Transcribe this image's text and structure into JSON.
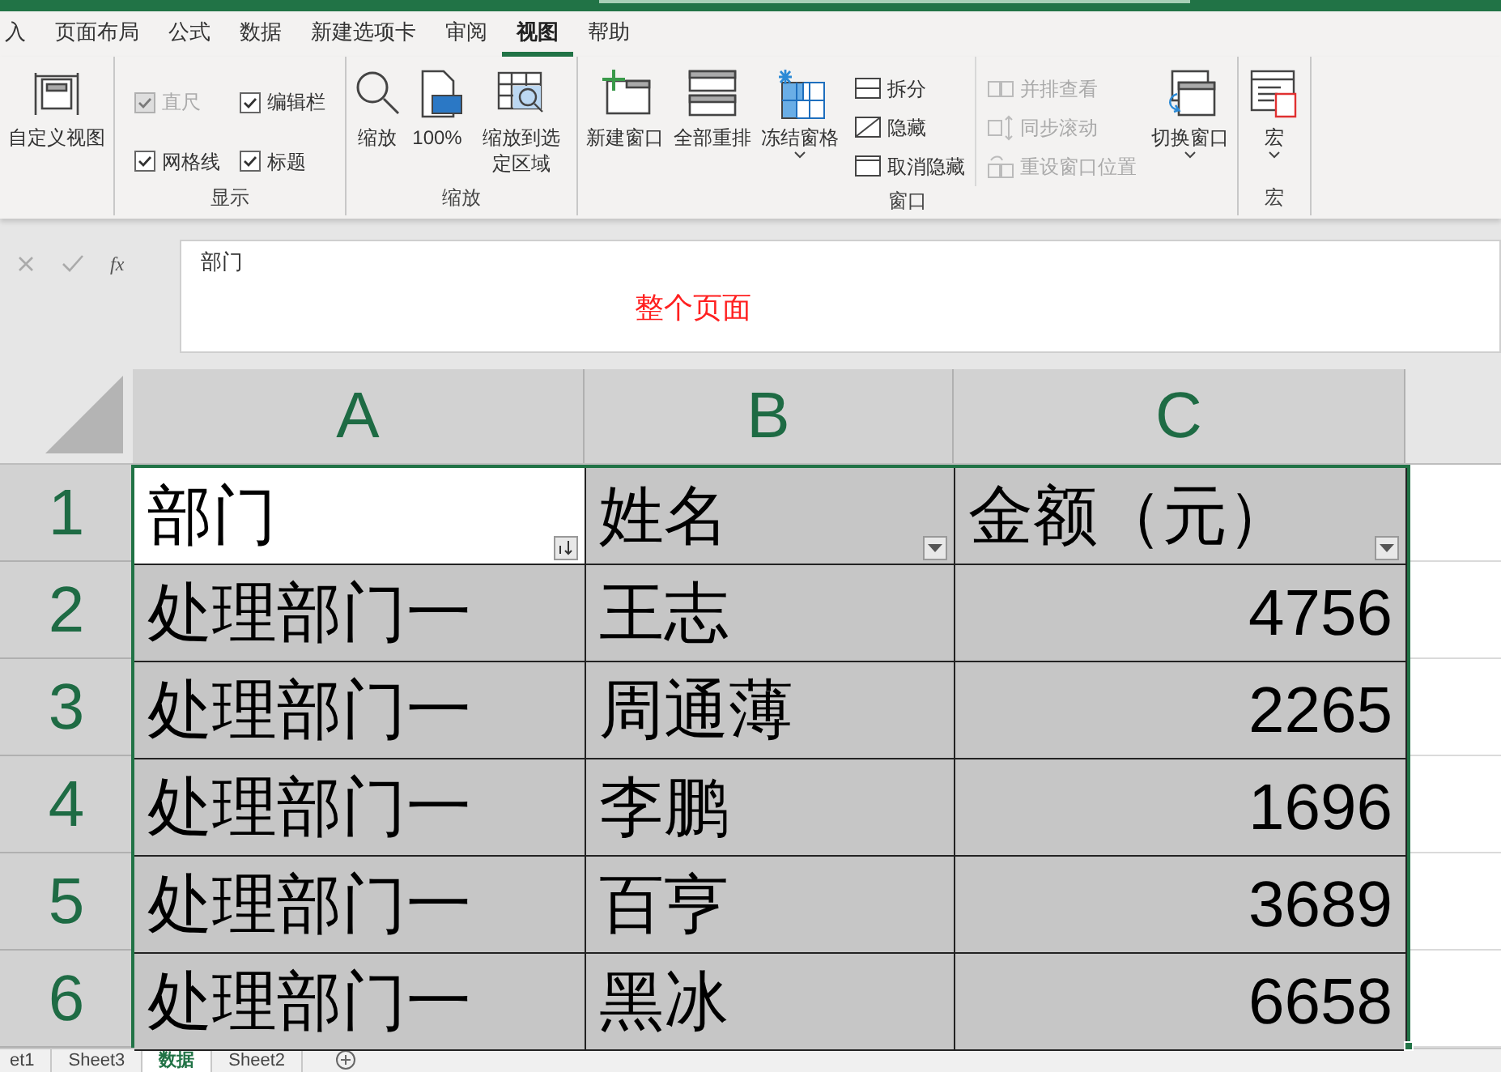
{
  "ribbon_tabs": [
    {
      "label": "入",
      "selected": false
    },
    {
      "label": "页面布局",
      "selected": false
    },
    {
      "label": "公式",
      "selected": false
    },
    {
      "label": "数据",
      "selected": false
    },
    {
      "label": "新建选项卡",
      "selected": false
    },
    {
      "label": "审阅",
      "selected": false
    },
    {
      "label": "视图",
      "selected": true
    },
    {
      "label": "帮助",
      "selected": false
    }
  ],
  "ribbon_groups": [
    {
      "items": [
        {
          "kind": "large",
          "label": "自定义视图",
          "dropdown": false
        }
      ]
    },
    {
      "label": "显示",
      "items": [
        {
          "kind": "checkbox",
          "label": "直尺",
          "checked": true,
          "disabled": true
        },
        {
          "kind": "checkbox",
          "label": "编辑栏",
          "checked": true,
          "disabled": false
        },
        {
          "kind": "checkbox",
          "label": "网格线",
          "checked": true,
          "disabled": false
        },
        {
          "kind": "checkbox",
          "label": "标题",
          "checked": true,
          "disabled": false
        }
      ]
    },
    {
      "label": "缩放",
      "items": [
        {
          "kind": "large",
          "label": "缩放",
          "dropdown": false
        },
        {
          "kind": "large",
          "label": "100%",
          "dropdown": false
        },
        {
          "kind": "large",
          "label": "缩放到选定区域",
          "dropdown": false
        }
      ]
    },
    {
      "label": "窗口",
      "items": [
        {
          "kind": "large",
          "label": "新建窗口",
          "dropdown": false
        },
        {
          "kind": "large",
          "label": "全部重排",
          "dropdown": false
        },
        {
          "kind": "large",
          "label": "冻结窗格",
          "dropdown": true
        },
        {
          "kind": "small",
          "label": "拆分",
          "disabled": false
        },
        {
          "kind": "small",
          "label": "隐藏",
          "disabled": false
        },
        {
          "kind": "small",
          "label": "取消隐藏",
          "disabled": false
        },
        {
          "kind": "small",
          "label": "并排查看",
          "disabled": true
        },
        {
          "kind": "small",
          "label": "同步滚动",
          "disabled": true
        },
        {
          "kind": "small",
          "label": "重设窗口位置",
          "disabled": true
        },
        {
          "kind": "large",
          "label": "切换窗口",
          "dropdown": true
        }
      ]
    },
    {
      "label": "宏",
      "items": [
        {
          "kind": "large",
          "label": "宏",
          "dropdown": true
        }
      ]
    }
  ],
  "formula_bar": {
    "function_label": "fx",
    "value": "部门",
    "annotation": "整个页面"
  },
  "columns": [
    "A",
    "B",
    "C"
  ],
  "rows": [
    {
      "number": "1",
      "cells": [
        {
          "text": "部门",
          "kind": "text",
          "active": true,
          "filter": {
            "kind": "sort"
          }
        },
        {
          "text": "姓名",
          "kind": "text",
          "active": false,
          "filter": {
            "kind": "dropdown"
          }
        },
        {
          "text": "金额（元）",
          "kind": "text",
          "active": false,
          "filter": {
            "kind": "dropdown"
          }
        }
      ]
    },
    {
      "number": "2",
      "cells": [
        {
          "text": "处理部门一",
          "kind": "text",
          "active": false
        },
        {
          "text": "王志",
          "kind": "text",
          "active": false
        },
        {
          "text": "4756",
          "kind": "number",
          "active": false
        }
      ]
    },
    {
      "number": "3",
      "cells": [
        {
          "text": "处理部门一",
          "kind": "text",
          "active": false
        },
        {
          "text": "周通薄",
          "kind": "text",
          "active": false
        },
        {
          "text": "2265",
          "kind": "number",
          "active": false
        }
      ]
    },
    {
      "number": "4",
      "cells": [
        {
          "text": "处理部门一",
          "kind": "text",
          "active": false
        },
        {
          "text": "李鹏",
          "kind": "text",
          "active": false
        },
        {
          "text": "1696",
          "kind": "number",
          "active": false
        }
      ]
    },
    {
      "number": "5",
      "cells": [
        {
          "text": "处理部门一",
          "kind": "text",
          "active": false
        },
        {
          "text": "百亨",
          "kind": "text",
          "active": false
        },
        {
          "text": "3689",
          "kind": "number",
          "active": false
        }
      ]
    },
    {
      "number": "6",
      "cells": [
        {
          "text": "处理部门一",
          "kind": "text",
          "active": false
        },
        {
          "text": "黑冰",
          "kind": "text",
          "active": false
        },
        {
          "text": "6658",
          "kind": "number",
          "active": false
        }
      ]
    }
  ],
  "sheet_tabs": [
    {
      "label": "et1",
      "selected": false
    },
    {
      "label": "Sheet3",
      "selected": false
    },
    {
      "label": "数据",
      "selected": true
    },
    {
      "label": "Sheet2",
      "selected": false
    }
  ]
}
